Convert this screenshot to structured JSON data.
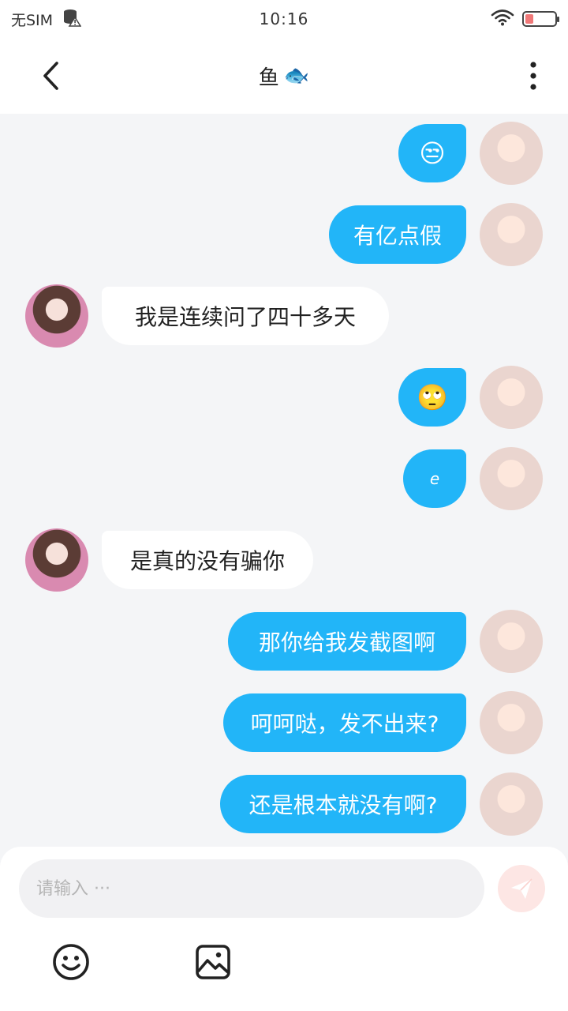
{
  "status_bar": {
    "carrier": "无SIM",
    "time": "10:16"
  },
  "header": {
    "title": "鱼",
    "title_emoji": "🐟"
  },
  "messages": [
    {
      "side": "me",
      "text": "😒"
    },
    {
      "side": "me",
      "text": "有亿点假"
    },
    {
      "side": "other",
      "text": "我是连续问了四十多天"
    },
    {
      "side": "me",
      "text": "🙄"
    },
    {
      "side": "me",
      "text": "e"
    },
    {
      "side": "other",
      "text": "是真的没有骗你"
    },
    {
      "side": "me",
      "text": "那你给我发截图啊"
    },
    {
      "side": "me",
      "text": "呵呵哒，发不出来?"
    },
    {
      "side": "me",
      "text": "还是根本就没有啊?"
    }
  ],
  "composer": {
    "placeholder": "请输入 ···"
  },
  "icons": {
    "back": "chevron-left-icon",
    "more": "more-vertical-icon",
    "send": "send-icon",
    "emoji": "smiley-icon",
    "image": "image-icon"
  },
  "colors": {
    "my_bubble": "#22b5f8",
    "other_bubble": "#ffffff",
    "background": "#f4f5f7",
    "send_button": "#fde6e4"
  }
}
